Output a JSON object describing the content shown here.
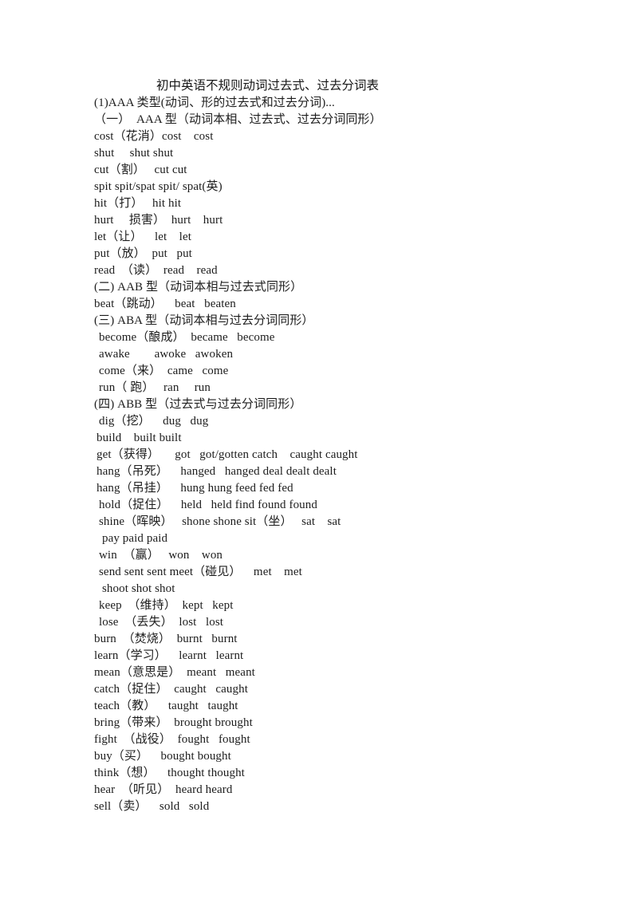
{
  "document": {
    "title": "初中英语不规则动词过去式、过去分词表",
    "intro": "(1)AAA 类型(动词、形的过去式和过去分词)...",
    "sections": [
      {
        "heading": "（一）  AAA 型（动词本相、过去式、过去分词同形）",
        "heading_indent": "ind-0",
        "entries": [
          {
            "text": "cost（花消）cost    cost",
            "indent": "ind-0"
          },
          {
            "text": "shut     shut shut",
            "indent": "ind-0"
          },
          {
            "text": "cut（割）   cut cut",
            "indent": "ind-0"
          },
          {
            "text": "spit spit/spat spit/ spat(英)",
            "indent": "ind-0"
          },
          {
            "text": "hit（打）   hit hit",
            "indent": "ind-0"
          },
          {
            "text": "hurt     损害）  hurt    hurt",
            "indent": "ind-0"
          },
          {
            "text": "let（让）    let    let",
            "indent": "ind-0"
          },
          {
            "text": "put（放）  put   put",
            "indent": "ind-0"
          },
          {
            "text": "read  （读）  read    read",
            "indent": "ind-0"
          }
        ]
      },
      {
        "heading": "(二) AAB 型（动词本相与过去式同形）",
        "heading_indent": "ind-0",
        "entries": [
          {
            "text": "beat（跳动）    beat   beaten",
            "indent": "ind-0"
          }
        ]
      },
      {
        "heading": "(三) ABA 型（动词本相与过去分词同形）",
        "heading_indent": "ind-0",
        "entries": [
          {
            "text": "become（酿成）  became   become",
            "indent": "ind-2"
          },
          {
            "text": "awake        awoke   awoken",
            "indent": "ind-2"
          },
          {
            "text": "come（来）  came   come",
            "indent": "ind-2"
          },
          {
            "text": "run（ 跑）   ran     run",
            "indent": "ind-2"
          }
        ]
      },
      {
        "heading": "(四) ABB 型（过去式与过去分词同形）",
        "heading_indent": "ind-0",
        "entries": [
          {
            "text": "dig（挖）    dug   dug",
            "indent": "ind-2"
          },
          {
            "text": "build    built built",
            "indent": "ind-1"
          },
          {
            "text": "get（获得）     got   got/gotten catch    caught caught",
            "indent": "ind-1"
          },
          {
            "text": "hang（吊死）    hanged   hanged deal dealt dealt",
            "indent": "ind-1"
          },
          {
            "text": "hang（吊挂）    hung hung feed fed fed",
            "indent": "ind-1"
          },
          {
            "text": "hold（捉住）    held   held find found found",
            "indent": "ind-2"
          },
          {
            "text": "shine（晖映）   shone shone sit（坐）   sat    sat",
            "indent": "ind-2"
          },
          {
            "text": "pay paid paid",
            "indent": "ind-3"
          },
          {
            "text": "win  （赢）   won    won",
            "indent": "ind-2"
          },
          {
            "text": "send sent sent meet（碰见）    met    met",
            "indent": "ind-2"
          },
          {
            "text": "shoot shot shot",
            "indent": "ind-3"
          },
          {
            "text": "keep  （维持）  kept   kept",
            "indent": "ind-2"
          },
          {
            "text": "lose  （丢失）  lost   lost",
            "indent": "ind-2"
          },
          {
            "text": "burn  （焚烧）  burnt   burnt",
            "indent": "ind-0"
          },
          {
            "text": "learn（学习）    learnt   learnt",
            "indent": "ind-0"
          },
          {
            "text": "mean（意思是）  meant   meant",
            "indent": "ind-0"
          },
          {
            "text": "catch（捉住）  caught   caught",
            "indent": "ind-0"
          },
          {
            "text": "teach（教）    taught   taught",
            "indent": "ind-0"
          },
          {
            "text": "bring（带来）  brought brought",
            "indent": "ind-0"
          },
          {
            "text": "fight  （战役）  fought   fought",
            "indent": "ind-0"
          },
          {
            "text": "buy（买）    bought bought",
            "indent": "ind-0"
          },
          {
            "text": "think（想）    thought thought",
            "indent": "ind-0"
          },
          {
            "text": "hear  （听见）  heard heard",
            "indent": "ind-0"
          },
          {
            "text": "sell（卖）    sold   sold",
            "indent": "ind-0"
          }
        ]
      }
    ]
  }
}
